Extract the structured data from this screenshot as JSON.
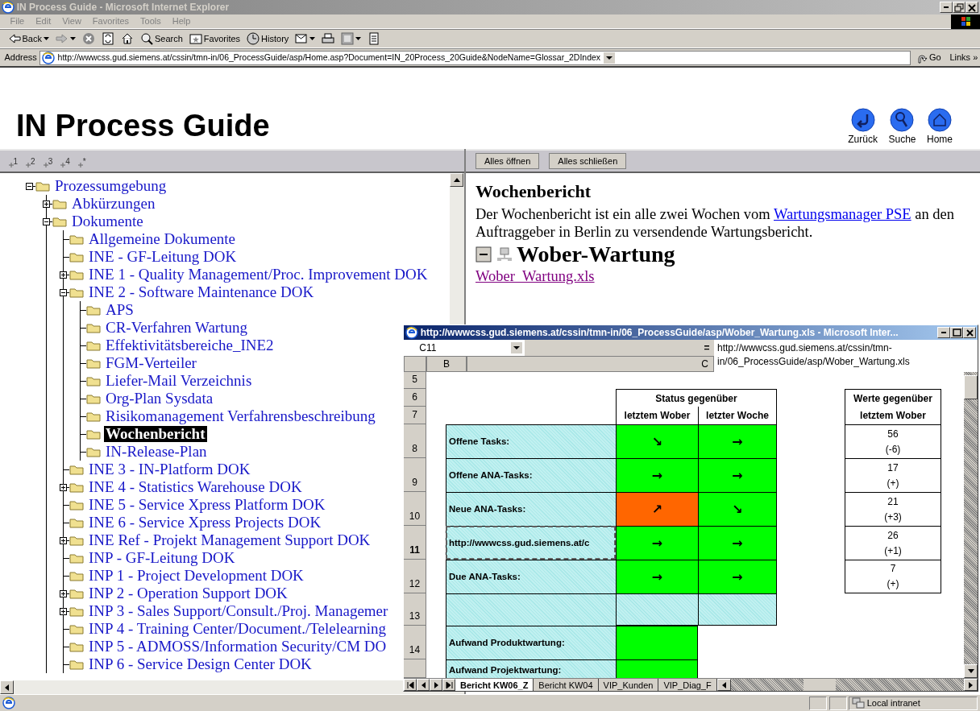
{
  "window": {
    "title": "IN Process Guide - Microsoft Internet Explorer"
  },
  "menu": [
    "File",
    "Edit",
    "View",
    "Favorites",
    "Tools",
    "Help"
  ],
  "toolbar": [
    {
      "kind": "back",
      "label": "Back",
      "dropdown": true
    },
    {
      "kind": "forward",
      "dropdown": true
    },
    {
      "kind": "stop",
      "dropdown": false
    },
    {
      "kind": "refresh",
      "dropdown": false
    },
    {
      "kind": "home",
      "dropdown": false
    },
    {
      "kind": "search",
      "label": "Search",
      "dropdown": false
    },
    {
      "kind": "favorites",
      "label": "Favorites",
      "dropdown": false
    },
    {
      "kind": "history",
      "label": "History",
      "dropdown": false
    },
    {
      "kind": "mail",
      "dropdown": true
    },
    {
      "kind": "print",
      "dropdown": false
    },
    {
      "kind": "edit",
      "dropdown": true
    },
    {
      "kind": "discuss",
      "dropdown": false
    }
  ],
  "address": {
    "label": "Address",
    "url": "http://wwwcss.gud.siemens.at/cssin/tmn-in/06_ProcessGuide/asp/Home.asp?Document=IN_20Process_20Guide&NodeName=Glossar_2DIndex",
    "go": "Go",
    "links": "Links »"
  },
  "page": {
    "title": "IN Process Guide",
    "nav": [
      {
        "kind": "back",
        "label": "Zurück"
      },
      {
        "kind": "search",
        "label": "Suche"
      },
      {
        "kind": "home",
        "label": "Home"
      }
    ],
    "level_buttons": [
      "1",
      "2",
      "3",
      "4",
      "*"
    ],
    "buttons": [
      "Alles öffnen",
      "Alles schließen"
    ],
    "tree": [
      {
        "label": "Prozessumgebung",
        "selected": false,
        "expanded": true,
        "children": [
          {
            "label": "Abkürzungen",
            "selected": false,
            "expanded": false
          },
          {
            "label": "Dokumente",
            "selected": false,
            "expanded": true,
            "children": [
              {
                "label": "Allgemeine Dokumente",
                "selected": false
              },
              {
                "label": "INE - GF-Leitung DOK",
                "selected": false
              },
              {
                "label": "INE 1 - Quality Management/Proc. Improvement DOK",
                "selected": false,
                "expanded": false
              },
              {
                "label": "INE 2 - Software Maintenance DOK",
                "selected": false,
                "expanded": true,
                "children": [
                  {
                    "label": "APS",
                    "selected": false
                  },
                  {
                    "label": "CR-Verfahren Wartung",
                    "selected": false
                  },
                  {
                    "label": "Effektivitätsbereiche_INE2",
                    "selected": false
                  },
                  {
                    "label": "FGM-Verteiler",
                    "selected": false
                  },
                  {
                    "label": "Liefer-Mail Verzeichnis",
                    "selected": false
                  },
                  {
                    "label": "Org-Plan Sysdata",
                    "selected": false
                  },
                  {
                    "label": "Risikomanagement Verfahrensbeschreibung",
                    "selected": false
                  },
                  {
                    "label": "Wochenbericht",
                    "selected": true
                  },
                  {
                    "label": "IN-Release-Plan",
                    "selected": false
                  }
                ]
              },
              {
                "label": "INE 3 - IN-Platform DOK",
                "selected": false
              },
              {
                "label": "INE 4 - Statistics Warehouse DOK",
                "selected": false,
                "expanded": false
              },
              {
                "label": "INE 5 - Service Xpress Platform DOK",
                "selected": false
              },
              {
                "label": "INE 6 - Service Xpress Projects DOK",
                "selected": false
              },
              {
                "label": "INE Ref - Projekt Management Support DOK",
                "selected": false,
                "expanded": false
              },
              {
                "label": "INP - GF-Leitung DOK",
                "selected": false
              },
              {
                "label": "INP 1 - Project Development DOK",
                "selected": false
              },
              {
                "label": "INP 2 - Operation Support DOK",
                "selected": false,
                "expanded": false
              },
              {
                "label": "INP 3 - Sales Support/Consult./Proj. Managemer",
                "selected": false,
                "expanded": false
              },
              {
                "label": "INP 4 - Training Center/Document./Telelearning",
                "selected": false
              },
              {
                "label": "INP 5 - ADMOSS/Information Security/CM DO",
                "selected": false
              },
              {
                "label": "INP 6 - Service Design Center DOK",
                "selected": false
              }
            ]
          }
        ]
      }
    ],
    "content": {
      "heading": "Wochenbericht",
      "text_before": "Der Wochenbericht ist ein alle zwei Wochen vom ",
      "link": "Wartungsmanager PSE",
      "text_after": " an den Auftraggeber in Berlin zu versendende Wartungsbericht.",
      "section": {
        "title": "Wober-Wartung",
        "expanded": true,
        "file": "Wober_Wartung.xls"
      }
    }
  },
  "excel": {
    "title": "http://wwwcss.gud.siemens.at/cssin/tmn-in/06_ProcessGuide/asp/Wober_Wartung.xls - Microsoft Inter...",
    "name_box": "C11",
    "formula_sign": "=",
    "formula": "http://wwwcss.gud.siemens.at/cssin/tmn-in/06_ProcessGuide/asp/Wober_Wartung.xls",
    "columns": [
      "B",
      "C"
    ],
    "row_numbers": [
      {
        "label": "5",
        "selected": false
      },
      {
        "label": "6",
        "selected": false
      },
      {
        "label": "7",
        "selected": false
      },
      {
        "label": "8",
        "selected": false
      },
      {
        "label": "9",
        "selected": false
      },
      {
        "label": "10",
        "selected": false
      },
      {
        "label": "11",
        "selected": true
      },
      {
        "label": "12",
        "selected": false
      },
      {
        "label": "13",
        "selected": false
      },
      {
        "label": "14",
        "selected": false
      }
    ],
    "header": {
      "status": "Status gegenüber",
      "status_1": "letztem Wober",
      "status_2": "letzter Woche",
      "values": "Werte gegenüber",
      "values_2": "letztem Wober"
    },
    "rows": [
      {
        "kind": "task",
        "label": "Offene Tasks:",
        "active": false,
        "status": [
          {
            "arrow": "↘",
            "color": "#00ff00"
          },
          {
            "arrow": "→",
            "color": "#00ff00"
          }
        ],
        "value": "56",
        "change": "(-6)"
      },
      {
        "kind": "task",
        "label": "Offene ANA-Tasks:",
        "active": false,
        "status": [
          {
            "arrow": "→",
            "color": "#00ff00"
          },
          {
            "arrow": "→",
            "color": "#00ff00"
          }
        ],
        "value": "17",
        "change": "(+)"
      },
      {
        "kind": "task",
        "label": "Neue ANA-Tasks:",
        "active": false,
        "status": [
          {
            "arrow": "↗",
            "color": "#ff6600"
          },
          {
            "arrow": "↘",
            "color": "#00ff00"
          }
        ],
        "value": "21",
        "change": "(+3)"
      },
      {
        "kind": "task",
        "label": "http://wwwcss.gud.siemens.at/c",
        "active": true,
        "status": [
          {
            "arrow": "→",
            "color": "#00ff00"
          },
          {
            "arrow": "→",
            "color": "#00ff00"
          }
        ],
        "value": "26",
        "change": "(+1)"
      },
      {
        "kind": "task",
        "label": "Due ANA-Tasks:",
        "active": false,
        "status": [
          {
            "arrow": "→",
            "color": "#00ff00"
          },
          {
            "arrow": "→",
            "color": "#00ff00"
          }
        ],
        "value": "7",
        "change": "(+)"
      },
      {
        "kind": "blank"
      },
      {
        "kind": "effort",
        "label": "Aufwand Produktwartung:",
        "active": false,
        "status": [
          {
            "color": "#00ff00"
          }
        ]
      },
      {
        "kind": "effort",
        "label": "Aufwand Projektwartung:",
        "active": false,
        "status": [
          {
            "color": "#00ff00"
          }
        ]
      }
    ],
    "sheets": [
      {
        "label": "Bericht KW06_Z",
        "selected": true
      },
      {
        "label": "Bericht KW04",
        "selected": false
      },
      {
        "label": "VIP_Kunden",
        "selected": false
      },
      {
        "label": "VIP_Diag_F",
        "selected": false
      }
    ]
  },
  "status_bar": {
    "zone": "Local intranet"
  }
}
